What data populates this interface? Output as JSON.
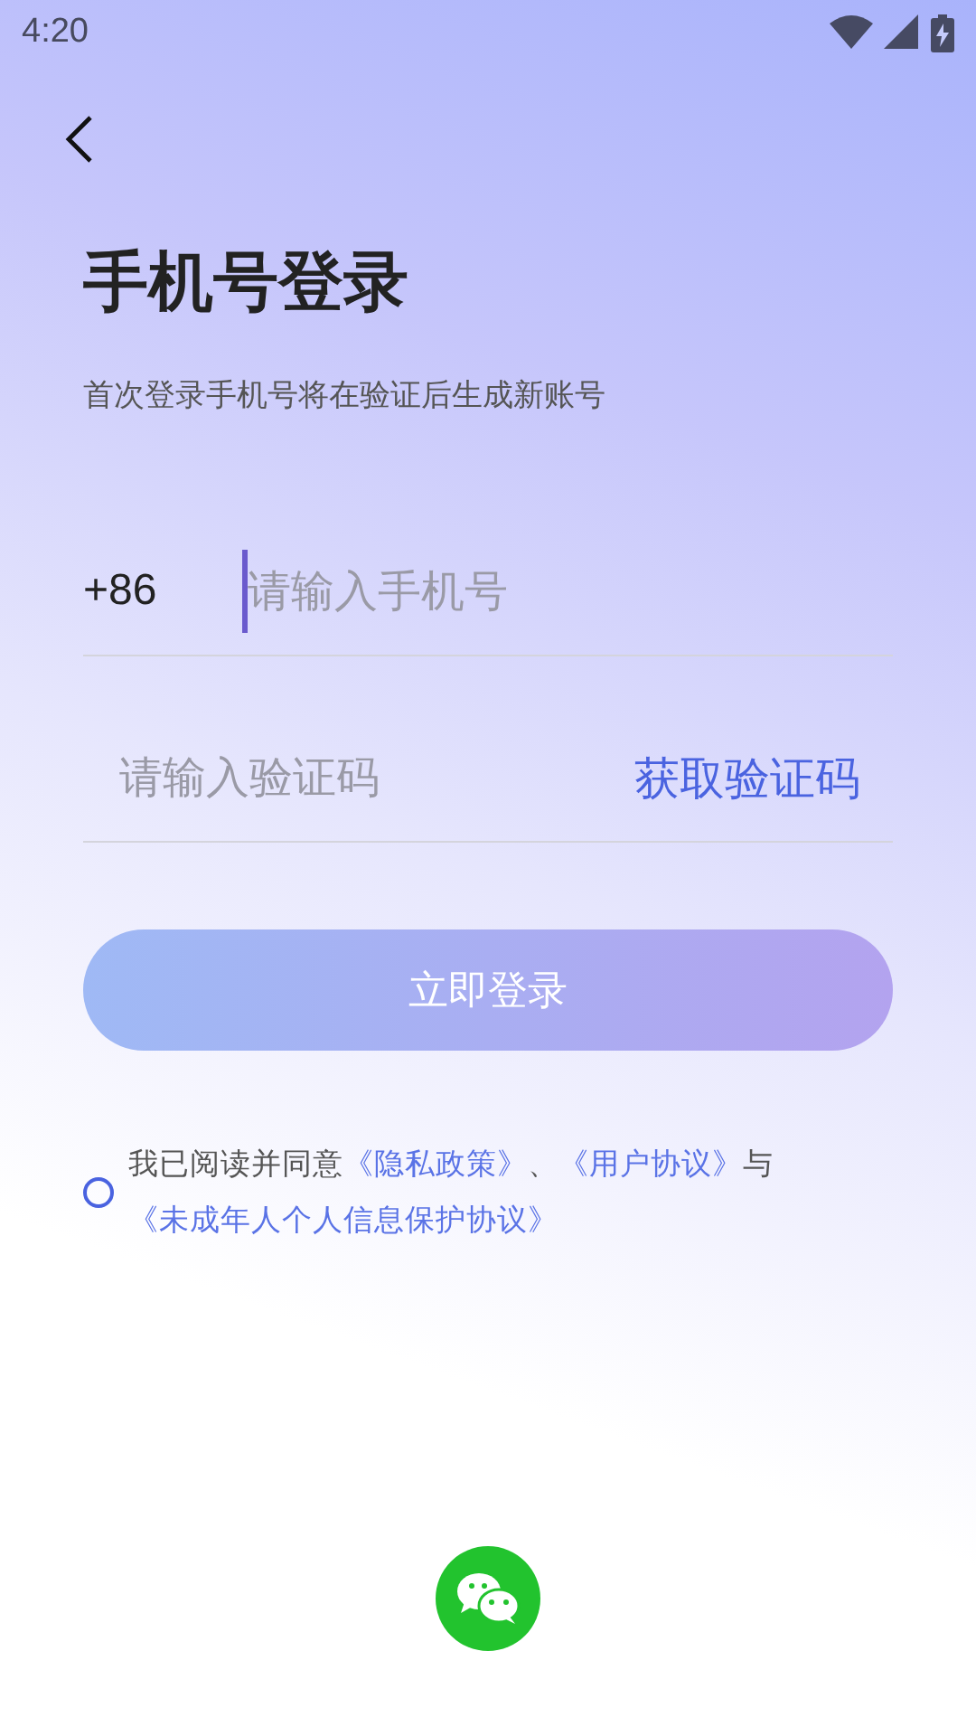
{
  "status_bar": {
    "time": "4:20"
  },
  "title": "手机号登录",
  "subtitle": "首次登录手机号将在验证后生成新账号",
  "phone_field": {
    "prefix": "+86",
    "placeholder": "请输入手机号",
    "focused": true
  },
  "code_field": {
    "placeholder": "请输入验证码",
    "action": "获取验证码"
  },
  "login_button": {
    "label": "立即登录",
    "disabled": true
  },
  "agreement": {
    "checked": false,
    "parts": [
      {
        "kind": "text",
        "text": "我已阅读并同意"
      },
      {
        "kind": "link",
        "text": "《隐私政策》"
      },
      {
        "kind": "text",
        "text": "、"
      },
      {
        "kind": "link",
        "text": "《用户协议》"
      },
      {
        "kind": "text",
        "text": "与"
      },
      {
        "kind": "link",
        "text": "《未成年人个人信息保护协议》"
      }
    ]
  }
}
